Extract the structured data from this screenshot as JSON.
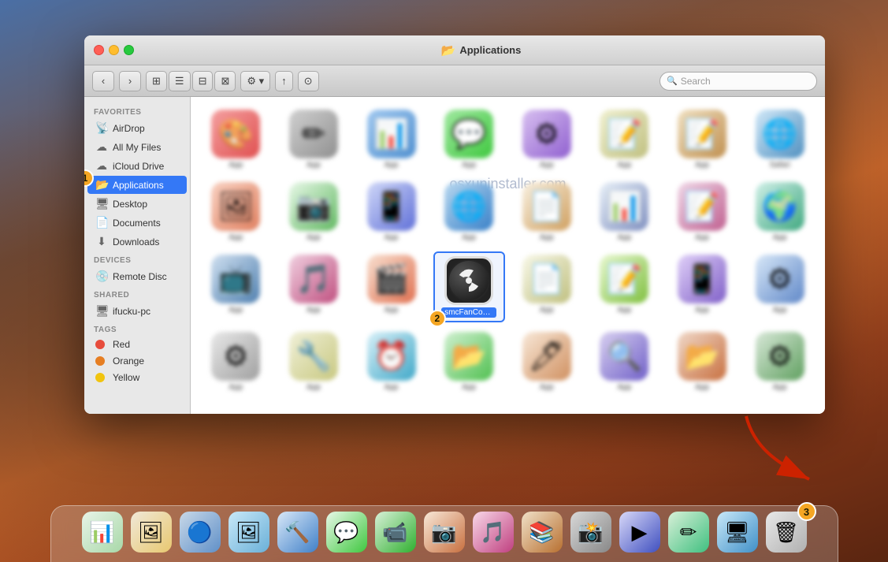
{
  "desktop": {
    "bg": "macOS Sierra mountain"
  },
  "finder_window": {
    "title": "Applications",
    "title_icon": "📂",
    "traffic_lights": {
      "close": "close",
      "minimize": "minimize",
      "maximize": "maximize"
    }
  },
  "toolbar": {
    "back_label": "‹",
    "forward_label": "›",
    "view_icons": [
      "⊞",
      "☰",
      "⊟",
      "⊠"
    ],
    "arrange_label": "⚙",
    "share_label": "↑",
    "tag_label": "⊙",
    "search_placeholder": "Search"
  },
  "sidebar": {
    "sections": [
      {
        "label": "Favorites",
        "items": [
          {
            "icon": "📡",
            "label": "AirDrop",
            "active": false
          },
          {
            "icon": "☁",
            "label": "All My Files",
            "active": false
          },
          {
            "icon": "☁",
            "label": "iCloud Drive",
            "active": false
          },
          {
            "icon": "📂",
            "label": "Applications",
            "active": true
          },
          {
            "icon": "🖥",
            "label": "Desktop",
            "active": false
          },
          {
            "icon": "📄",
            "label": "Documents",
            "active": false
          },
          {
            "icon": "⬇",
            "label": "Downloads",
            "active": false
          }
        ]
      },
      {
        "label": "Devices",
        "items": [
          {
            "icon": "💿",
            "label": "Remote Disc",
            "active": false
          }
        ]
      },
      {
        "label": "Shared",
        "items": [
          {
            "icon": "🖥",
            "label": "ifucku-pc",
            "active": false
          }
        ]
      },
      {
        "label": "Tags",
        "items": [
          {
            "color": "#e74c3c",
            "label": "Red",
            "active": false
          },
          {
            "color": "#e67e22",
            "label": "Orange",
            "active": false
          },
          {
            "color": "#f1c40f",
            "label": "Yellow",
            "active": false
          }
        ]
      }
    ]
  },
  "apps_grid": {
    "rows": [
      [
        {
          "name": "",
          "blurred": true,
          "emoji": "🎨"
        },
        {
          "name": "",
          "blurred": true,
          "emoji": "🖊"
        },
        {
          "name": "",
          "blurred": true,
          "emoji": "📊"
        },
        {
          "name": "",
          "blurred": true,
          "emoji": "💬"
        },
        {
          "name": "",
          "blurred": true,
          "emoji": "⚙"
        },
        {
          "name": "",
          "blurred": true,
          "emoji": "📝"
        },
        {
          "name": "",
          "blurred": true,
          "emoji": "📝"
        },
        {
          "name": "",
          "blurred": true,
          "emoji": "🌐"
        }
      ],
      [
        {
          "name": "",
          "blurred": true,
          "emoji": "🖼"
        },
        {
          "name": "",
          "blurred": true,
          "emoji": "📷"
        },
        {
          "name": "",
          "blurred": true,
          "emoji": "📱"
        },
        {
          "name": "",
          "blurred": true,
          "emoji": "🌐"
        },
        {
          "name": "",
          "blurred": true,
          "emoji": "📄"
        },
        {
          "name": "",
          "blurred": true,
          "emoji": "📊"
        },
        {
          "name": "",
          "blurred": true,
          "emoji": "📝"
        },
        {
          "name": "",
          "blurred": true,
          "emoji": "🌍"
        }
      ],
      [
        {
          "name": "",
          "blurred": true,
          "emoji": "📺"
        },
        {
          "name": "",
          "blurred": true,
          "emoji": "🎵"
        },
        {
          "name": "",
          "blurred": false,
          "emoji": "🎬",
          "special": "smcFanControl"
        },
        {
          "name": "smcFanControl",
          "blurred": false,
          "emoji": "☢",
          "selected": true
        },
        {
          "name": "",
          "blurred": true,
          "emoji": "📄"
        },
        {
          "name": "",
          "blurred": true,
          "emoji": "📝"
        },
        {
          "name": "",
          "blurred": true,
          "emoji": "📱"
        },
        {
          "name": "",
          "blurred": true,
          "emoji": "⚙"
        }
      ],
      [
        {
          "name": "",
          "blurred": true,
          "emoji": "⚙"
        },
        {
          "name": "",
          "blurred": true,
          "emoji": "🔧"
        },
        {
          "name": "",
          "blurred": true,
          "emoji": "⏰"
        },
        {
          "name": "",
          "blurred": true,
          "emoji": "📂"
        },
        {
          "name": "",
          "blurred": true,
          "emoji": "🖊"
        },
        {
          "name": "",
          "blurred": true,
          "emoji": "🔍"
        },
        {
          "name": "",
          "blurred": true,
          "emoji": "📂"
        },
        {
          "name": "",
          "blurred": true,
          "emoji": "⚙"
        }
      ]
    ]
  },
  "watermark": "osxuninstaller.com",
  "badges": {
    "badge1_label": "1",
    "badge2_label": "2",
    "badge3_label": "3"
  },
  "dock": {
    "items": [
      {
        "name": "activity-monitor",
        "emoji": "📊",
        "bg": "activity-monitor"
      },
      {
        "name": "preview",
        "emoji": "🖼",
        "bg": "preview-app"
      },
      {
        "name": "quicksilver",
        "emoji": "🔵",
        "bg": "quicksilver"
      },
      {
        "name": "iphoto",
        "emoji": "🖼",
        "bg": "iphoto"
      },
      {
        "name": "xcode",
        "emoji": "🔨",
        "bg": "xcode"
      },
      {
        "name": "messages",
        "emoji": "💬",
        "bg": "messages-app"
      },
      {
        "name": "facetime",
        "emoji": "📹",
        "bg": "facetime"
      },
      {
        "name": "photos",
        "emoji": "📷",
        "bg": "photos-app"
      },
      {
        "name": "itunes",
        "emoji": "🎵",
        "bg": "itunes"
      },
      {
        "name": "ibooks",
        "emoji": "📚",
        "bg": "ibooks"
      },
      {
        "name": "photo-booth",
        "emoji": "📸",
        "bg": "photo-booth"
      },
      {
        "name": "quicktime",
        "emoji": "▶",
        "bg": "quicktime"
      },
      {
        "name": "sketchbook",
        "emoji": "✏",
        "bg": "sketchbook"
      },
      {
        "name": "finder",
        "emoji": "🖥",
        "bg": "finder-app"
      },
      {
        "name": "trash",
        "emoji": "🗑",
        "bg": "trash-app"
      }
    ]
  }
}
